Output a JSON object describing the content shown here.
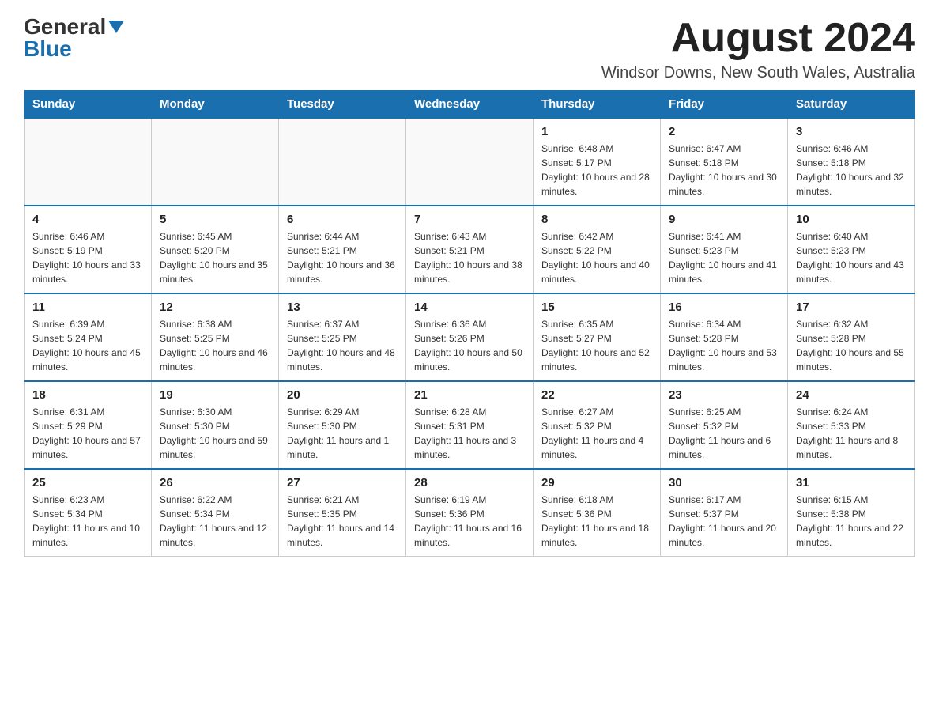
{
  "header": {
    "logo_general": "General",
    "logo_blue": "Blue",
    "month_title": "August 2024",
    "location": "Windsor Downs, New South Wales, Australia"
  },
  "days_of_week": [
    "Sunday",
    "Monday",
    "Tuesday",
    "Wednesday",
    "Thursday",
    "Friday",
    "Saturday"
  ],
  "weeks": [
    [
      {
        "day": "",
        "info": ""
      },
      {
        "day": "",
        "info": ""
      },
      {
        "day": "",
        "info": ""
      },
      {
        "day": "",
        "info": ""
      },
      {
        "day": "1",
        "info": "Sunrise: 6:48 AM\nSunset: 5:17 PM\nDaylight: 10 hours and 28 minutes."
      },
      {
        "day": "2",
        "info": "Sunrise: 6:47 AM\nSunset: 5:18 PM\nDaylight: 10 hours and 30 minutes."
      },
      {
        "day": "3",
        "info": "Sunrise: 6:46 AM\nSunset: 5:18 PM\nDaylight: 10 hours and 32 minutes."
      }
    ],
    [
      {
        "day": "4",
        "info": "Sunrise: 6:46 AM\nSunset: 5:19 PM\nDaylight: 10 hours and 33 minutes."
      },
      {
        "day": "5",
        "info": "Sunrise: 6:45 AM\nSunset: 5:20 PM\nDaylight: 10 hours and 35 minutes."
      },
      {
        "day": "6",
        "info": "Sunrise: 6:44 AM\nSunset: 5:21 PM\nDaylight: 10 hours and 36 minutes."
      },
      {
        "day": "7",
        "info": "Sunrise: 6:43 AM\nSunset: 5:21 PM\nDaylight: 10 hours and 38 minutes."
      },
      {
        "day": "8",
        "info": "Sunrise: 6:42 AM\nSunset: 5:22 PM\nDaylight: 10 hours and 40 minutes."
      },
      {
        "day": "9",
        "info": "Sunrise: 6:41 AM\nSunset: 5:23 PM\nDaylight: 10 hours and 41 minutes."
      },
      {
        "day": "10",
        "info": "Sunrise: 6:40 AM\nSunset: 5:23 PM\nDaylight: 10 hours and 43 minutes."
      }
    ],
    [
      {
        "day": "11",
        "info": "Sunrise: 6:39 AM\nSunset: 5:24 PM\nDaylight: 10 hours and 45 minutes."
      },
      {
        "day": "12",
        "info": "Sunrise: 6:38 AM\nSunset: 5:25 PM\nDaylight: 10 hours and 46 minutes."
      },
      {
        "day": "13",
        "info": "Sunrise: 6:37 AM\nSunset: 5:25 PM\nDaylight: 10 hours and 48 minutes."
      },
      {
        "day": "14",
        "info": "Sunrise: 6:36 AM\nSunset: 5:26 PM\nDaylight: 10 hours and 50 minutes."
      },
      {
        "day": "15",
        "info": "Sunrise: 6:35 AM\nSunset: 5:27 PM\nDaylight: 10 hours and 52 minutes."
      },
      {
        "day": "16",
        "info": "Sunrise: 6:34 AM\nSunset: 5:28 PM\nDaylight: 10 hours and 53 minutes."
      },
      {
        "day": "17",
        "info": "Sunrise: 6:32 AM\nSunset: 5:28 PM\nDaylight: 10 hours and 55 minutes."
      }
    ],
    [
      {
        "day": "18",
        "info": "Sunrise: 6:31 AM\nSunset: 5:29 PM\nDaylight: 10 hours and 57 minutes."
      },
      {
        "day": "19",
        "info": "Sunrise: 6:30 AM\nSunset: 5:30 PM\nDaylight: 10 hours and 59 minutes."
      },
      {
        "day": "20",
        "info": "Sunrise: 6:29 AM\nSunset: 5:30 PM\nDaylight: 11 hours and 1 minute."
      },
      {
        "day": "21",
        "info": "Sunrise: 6:28 AM\nSunset: 5:31 PM\nDaylight: 11 hours and 3 minutes."
      },
      {
        "day": "22",
        "info": "Sunrise: 6:27 AM\nSunset: 5:32 PM\nDaylight: 11 hours and 4 minutes."
      },
      {
        "day": "23",
        "info": "Sunrise: 6:25 AM\nSunset: 5:32 PM\nDaylight: 11 hours and 6 minutes."
      },
      {
        "day": "24",
        "info": "Sunrise: 6:24 AM\nSunset: 5:33 PM\nDaylight: 11 hours and 8 minutes."
      }
    ],
    [
      {
        "day": "25",
        "info": "Sunrise: 6:23 AM\nSunset: 5:34 PM\nDaylight: 11 hours and 10 minutes."
      },
      {
        "day": "26",
        "info": "Sunrise: 6:22 AM\nSunset: 5:34 PM\nDaylight: 11 hours and 12 minutes."
      },
      {
        "day": "27",
        "info": "Sunrise: 6:21 AM\nSunset: 5:35 PM\nDaylight: 11 hours and 14 minutes."
      },
      {
        "day": "28",
        "info": "Sunrise: 6:19 AM\nSunset: 5:36 PM\nDaylight: 11 hours and 16 minutes."
      },
      {
        "day": "29",
        "info": "Sunrise: 6:18 AM\nSunset: 5:36 PM\nDaylight: 11 hours and 18 minutes."
      },
      {
        "day": "30",
        "info": "Sunrise: 6:17 AM\nSunset: 5:37 PM\nDaylight: 11 hours and 20 minutes."
      },
      {
        "day": "31",
        "info": "Sunrise: 6:15 AM\nSunset: 5:38 PM\nDaylight: 11 hours and 22 minutes."
      }
    ]
  ]
}
